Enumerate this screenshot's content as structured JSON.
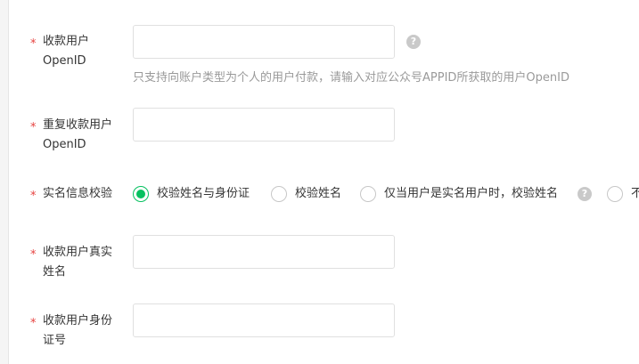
{
  "colors": {
    "accent": "#07c160",
    "required": "#e64340",
    "hint": "#9a9a9a"
  },
  "fields": [
    {
      "required_mark": "*",
      "label_line1": "收款用户",
      "label_line2": "OpenID",
      "value": "",
      "hint": "只支持向账户类型为个人的用户付款，请输入对应公众号APPID所获取的用户OpenID",
      "help_icon": "question-icon"
    },
    {
      "required_mark": "*",
      "label_line1": "重复收款用户",
      "label_line2": "OpenID",
      "value": ""
    },
    {
      "required_mark": "*",
      "label": "实名信息校验",
      "options": [
        {
          "label": "校验姓名与身份证",
          "checked": true
        },
        {
          "label": "校验姓名",
          "checked": false
        },
        {
          "label": "仅当用户是实名用户时，校验姓名",
          "checked": false,
          "help_icon": "question-icon"
        },
        {
          "label": "不",
          "checked": false
        }
      ]
    },
    {
      "required_mark": "*",
      "label_line1": "收款用户真实",
      "label_line2": "姓名",
      "value": ""
    },
    {
      "required_mark": "*",
      "label_line1": "收款用户身份",
      "label_line2": "证号",
      "value": ""
    }
  ]
}
